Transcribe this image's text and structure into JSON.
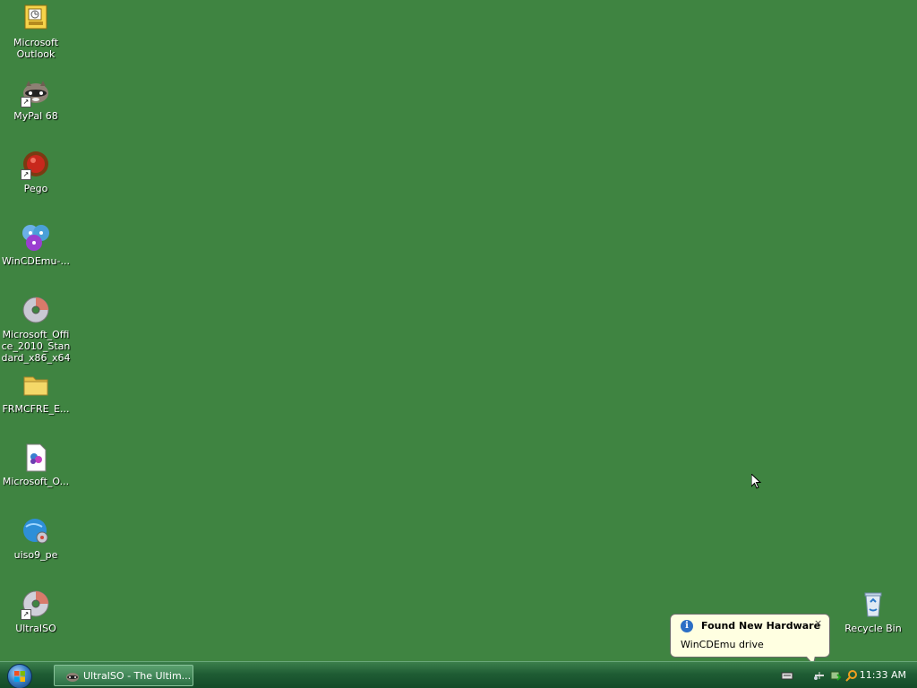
{
  "desktop": {
    "icons": [
      {
        "label": "Microsoft Outlook",
        "icon": "outlook-icon"
      },
      {
        "label": "MyPal 68",
        "icon": "mypal-raccoon-icon"
      },
      {
        "label": "Pego",
        "icon": "pego-icon"
      },
      {
        "label": "WinCDEmu-...",
        "icon": "wincdemu-discs-icon"
      },
      {
        "label": "Microsoft_Office_2010_Standard_x86_x64",
        "icon": "disc-image-icon"
      },
      {
        "label": "FRMCFRE_E...",
        "icon": "folder-icon"
      },
      {
        "label": "Microsoft_O...",
        "icon": "document-icon"
      },
      {
        "label": "uiso9_pe",
        "icon": "globe-disc-icon"
      },
      {
        "label": "UltraISO",
        "icon": "disc-icon"
      },
      {
        "label": "Recycle Bin",
        "icon": "recycle-bin-icon"
      }
    ]
  },
  "taskbar": {
    "start": "start-orb",
    "task_button_label": "UltraISO - The Ultim...",
    "clock": "11:33 AM",
    "tray_icons": [
      "keyboard-icon",
      "network-icon",
      "safely-remove-icon",
      "search-icon"
    ]
  },
  "balloon": {
    "title": "Found New Hardware",
    "message": "WinCDEmu drive",
    "close": "×"
  },
  "colors": {
    "desktop_bg": "#3f8441",
    "taskbar": "#1f5c34",
    "balloon_bg": "#ffffe1"
  }
}
